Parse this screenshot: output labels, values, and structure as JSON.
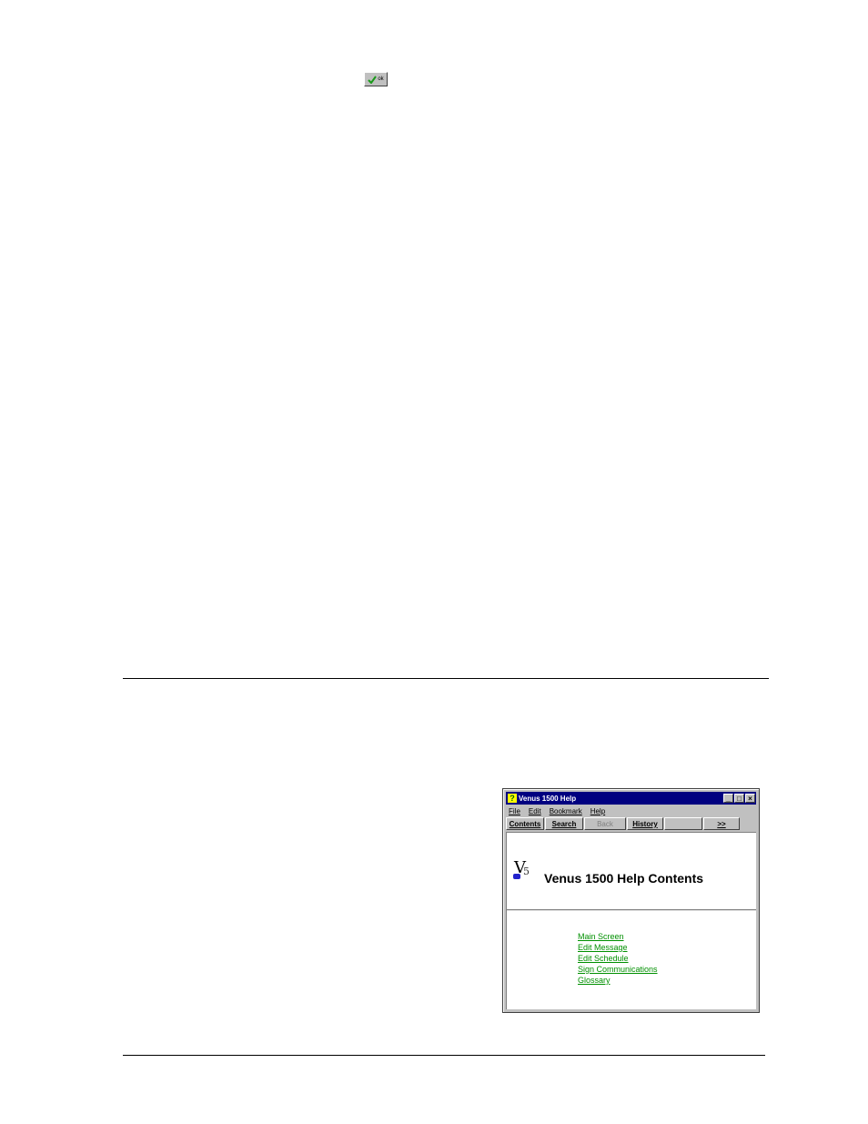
{
  "ok_button": {
    "label": "ok",
    "icon": "checkmark-icon",
    "icon_color": "#1a9a1a"
  },
  "help_window": {
    "title": "Venus 1500 Help",
    "title_bar_color": "#000080",
    "window_buttons": {
      "minimize": "_",
      "maximize": "□",
      "close": "×"
    },
    "menu": [
      "File",
      "Edit",
      "Bookmark",
      "Help"
    ],
    "toolbar": [
      {
        "label": "Contents",
        "enabled": true
      },
      {
        "label": "Search",
        "enabled": true
      },
      {
        "label": "Back",
        "enabled": false
      },
      {
        "label": "History",
        "enabled": true
      },
      {
        "label": "",
        "enabled": false
      },
      {
        "label": ">>",
        "enabled": true
      }
    ],
    "logo": {
      "letters": "V",
      "subscript": "5"
    },
    "heading": "Venus 1500 Help Contents",
    "topics": [
      "Main Screen",
      "Edit Message",
      "Edit Schedule",
      "Sign Communications",
      "Glossary"
    ],
    "link_color": "#009000"
  }
}
